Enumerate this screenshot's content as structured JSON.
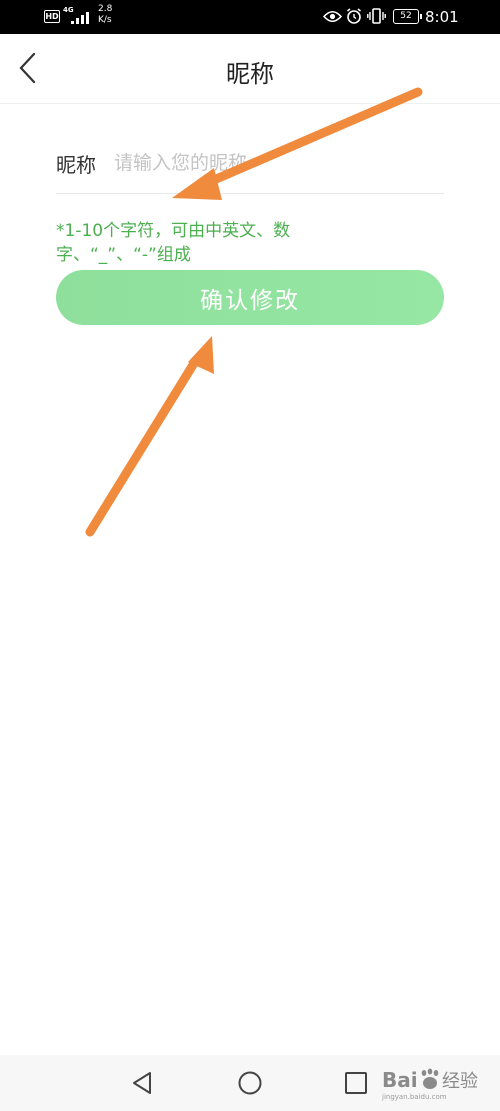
{
  "status_bar": {
    "hd_badge": "HD",
    "network_type": "4G",
    "speed_value": "2.8",
    "speed_unit": "K/s",
    "battery_level": "52",
    "time": "8:01",
    "icons": [
      "signal-icon",
      "eye-icon",
      "alarm-icon",
      "vibrate-icon",
      "battery-icon"
    ]
  },
  "nav": {
    "back_icon": "chevron-left-icon",
    "title": "昵称"
  },
  "form": {
    "field_label": "昵称",
    "input_value": "",
    "input_placeholder": "请输入您的昵称",
    "hint_line1": "*1-10个字符，可由中英文、数",
    "hint_line2": "字、“_”、“-”组成",
    "confirm_label": "确认修改"
  },
  "system_nav": {
    "buttons": [
      "back-triangle-icon",
      "home-circle-icon",
      "recents-square-icon"
    ]
  },
  "watermark": {
    "logo_text": "Bai经验",
    "sub_text": "jingyan.baidu.com"
  },
  "colors": {
    "accent_green": "#96e6a4",
    "hint_green": "#4caf50",
    "annotation_arrow": "#f08a3c",
    "status_bar_bg": "#000000"
  }
}
